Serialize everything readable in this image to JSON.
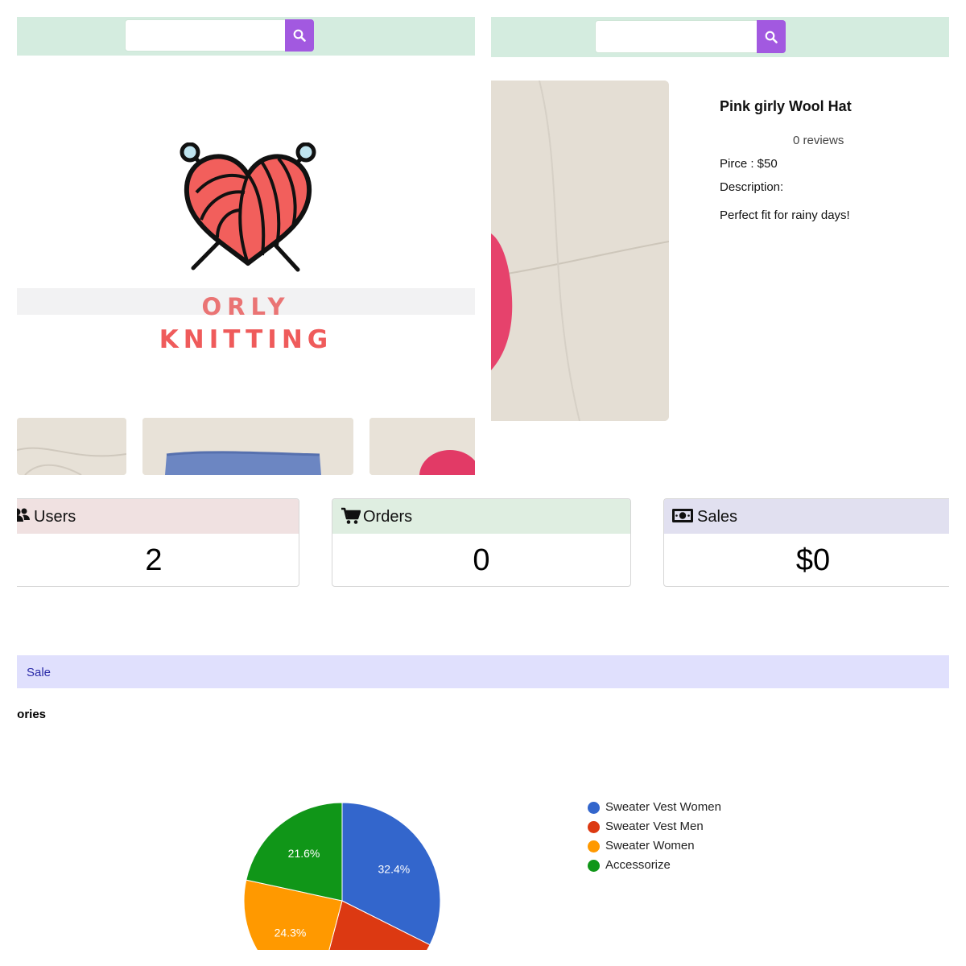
{
  "search_left": {
    "placeholder": ""
  },
  "search_right": {
    "placeholder": ""
  },
  "brand": {
    "line1": "ORLY",
    "line2": "KNITTING"
  },
  "product": {
    "name": "Pink girly Wool Hat",
    "reviews": "0 reviews",
    "price": "Pirce : $50",
    "description_label": "Description:",
    "description": "Perfect fit for rainy days!"
  },
  "stats": {
    "users": {
      "label": "Users",
      "value": "2",
      "icon": "users-icon",
      "color": "#f0e1e1"
    },
    "orders": {
      "label": "Orders",
      "value": "0",
      "icon": "cart-icon",
      "color": "#dfeee1"
    },
    "sales": {
      "label": "Sales",
      "value": "$0",
      "icon": "money-icon",
      "color": "#e1e0f0"
    }
  },
  "sale_bar": {
    "tab_label": "Sale"
  },
  "categories_title": "gories",
  "chart_data": {
    "type": "pie",
    "title": "",
    "slices": [
      {
        "name": "Sweater Vest Women",
        "value": 32.4,
        "label": "32.4%",
        "color": "#3366cc"
      },
      {
        "name": "Sweater Vest Men",
        "value": 21.7,
        "label": "",
        "color": "#dc3912"
      },
      {
        "name": "Sweater Women",
        "value": 24.3,
        "label": "24.3%",
        "color": "#ff9900"
      },
      {
        "name": "Accessorize",
        "value": 21.6,
        "label": "21.6%",
        "color": "#109618"
      }
    ],
    "legend_position": "right"
  }
}
